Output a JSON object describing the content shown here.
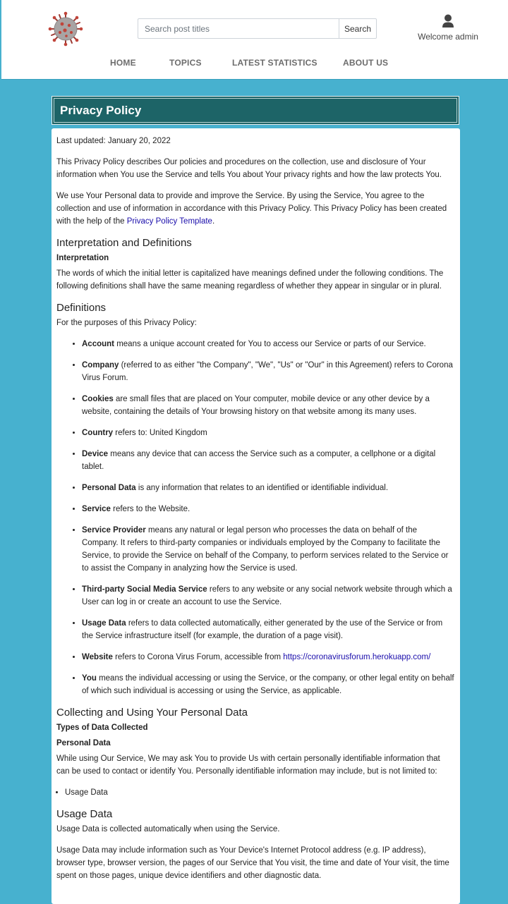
{
  "header": {
    "search": {
      "placeholder": "Search post titles",
      "button_label": "Search"
    },
    "user": {
      "welcome_text": "Welcome admin",
      "icon": "user-icon"
    },
    "logo": {
      "icon": "virus-logo-icon"
    },
    "nav": [
      {
        "label": "HOME"
      },
      {
        "label": "TOPICS"
      },
      {
        "label": "LATEST STATISTICS"
      },
      {
        "label": "ABOUT US"
      }
    ]
  },
  "page": {
    "title": "Privacy Policy",
    "last_updated": "Last updated: January 20, 2022",
    "intro1": "This Privacy Policy describes Our policies and procedures on the collection, use and disclosure of Your information when You use the Service and tells You about Your privacy rights and how the law protects You.",
    "intro2_text": "We use Your Personal data to provide and improve the Service. By using the Service, You agree to the collection and use of information in accordance with this Privacy Policy. This Privacy Policy has been created with the help of the ",
    "intro2_link": "Privacy Policy Template",
    "intro2_end": ".",
    "section_interp": "Interpretation and Definitions",
    "sub_interp": "Interpretation",
    "interp_text": "The words of which the initial letter is capitalized have meanings defined under the following conditions. The following definitions shall have the same meaning regardless of whether they appear in singular or in plural.",
    "section_defs": "Definitions",
    "defs_intro": "For the purposes of this Privacy Policy:",
    "definitions": [
      {
        "term": "Account",
        "text": " means a unique account created for You to access our Service or parts of our Service."
      },
      {
        "term": "Company",
        "text": " (referred to as either \"the Company\", \"We\", \"Us\" or \"Our\" in this Agreement) refers to Corona Virus Forum."
      },
      {
        "term": "Cookies",
        "text": " are small files that are placed on Your computer, mobile device or any other device by a website, containing the details of Your browsing history on that website among its many uses."
      },
      {
        "term": "Country",
        "text": " refers to: United Kingdom"
      },
      {
        "term": "Device",
        "text": " means any device that can access the Service such as a computer, a cellphone or a digital tablet."
      },
      {
        "term": "Personal Data",
        "text": " is any information that relates to an identified or identifiable individual."
      },
      {
        "term": "Service",
        "text": " refers to the Website."
      },
      {
        "term": "Service Provider",
        "text": " means any natural or legal person who processes the data on behalf of the Company. It refers to third-party companies or individuals employed by the Company to facilitate the Service, to provide the Service on behalf of the Company, to perform services related to the Service or to assist the Company in analyzing how the Service is used."
      },
      {
        "term": "Third-party Social Media Service",
        "text": " refers to any website or any social network website through which a User can log in or create an account to use the Service."
      },
      {
        "term": "Usage Data",
        "text": " refers to data collected automatically, either generated by the use of the Service or from the Service infrastructure itself (for example, the duration of a page visit)."
      },
      {
        "term": "Website",
        "text": " refers to Corona Virus Forum, accessible from ",
        "link": "https://coronavirusforum.herokuapp.com/"
      },
      {
        "term": "You",
        "text": " means the individual accessing or using the Service, or the company, or other legal entity on behalf of which such individual is accessing or using the Service, as applicable."
      }
    ],
    "section_collect": "Collecting and Using Your Personal Data",
    "sub_types": "Types of Data Collected",
    "sub_personal": "Personal Data",
    "personal_text": "While using Our Service, We may ask You to provide Us with certain personally identifiable information that can be used to contact or identify You. Personally identifiable information may include, but is not limited to:",
    "personal_items": [
      "Usage Data"
    ],
    "section_usage": "Usage Data",
    "usage_text1": "Usage Data is collected automatically when using the Service.",
    "usage_text2": "Usage Data may include information such as Your Device's Internet Protocol address (e.g. IP address), browser type, browser version, the pages of our Service that You visit, the time and date of Your visit, the time spent on those pages, unique device identifiers and other diagnostic data."
  }
}
